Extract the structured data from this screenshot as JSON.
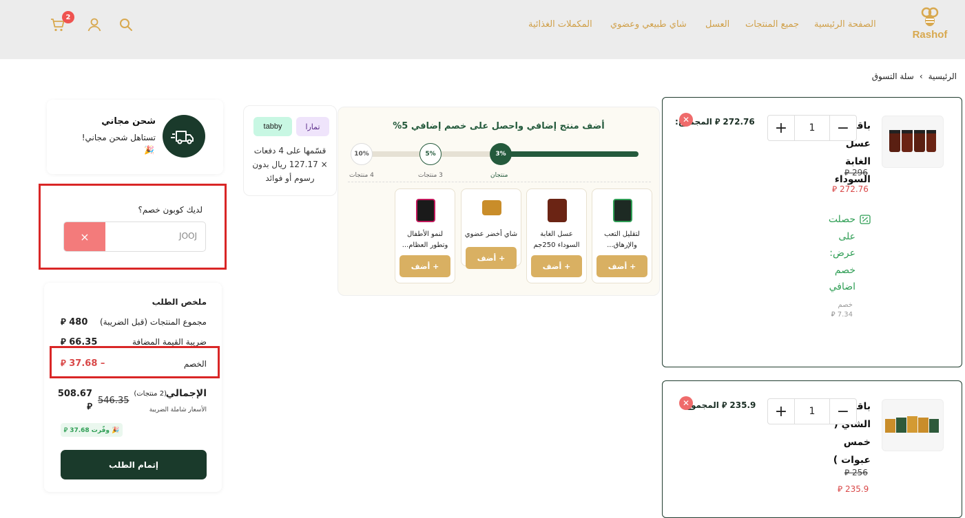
{
  "brand": {
    "name": "Rashof"
  },
  "nav": {
    "home": "الصفحة الرئيسية",
    "all_products": "جميع المنتجات",
    "honey": "العسل",
    "tea": "شاي طبيعي وعضوي",
    "supplements": "المكملات الغذائية"
  },
  "header": {
    "cart_count": "2"
  },
  "breadcrumb": {
    "home": "الرئيسية",
    "sep": "›",
    "current": "سلة التسوق"
  },
  "cart_items": [
    {
      "name": "باقة عسل الغابة السوداء",
      "old_price": "296 ⃁",
      "new_price": "272.76 ⃁",
      "qty": "1",
      "total_label": "المجموع:",
      "total_value": "272.76 ⃁",
      "offer": "حصلت على عرض: خصم اضافي",
      "discount_label": "خصم",
      "discount_value": "7.34 ⃁"
    },
    {
      "name": "باقة الشاي ( خمس عبوات )",
      "old_price": "256 ⃁",
      "new_price": "235.9 ⃁",
      "qty": "1",
      "total_label": "المجموع:",
      "total_value": "235.9 ⃁"
    }
  ],
  "upsell": {
    "title": "أضف منتج إضافي واحصل على خصم إضافي 5%",
    "steps": [
      {
        "pct": "3%",
        "label": "منتجان"
      },
      {
        "pct": "5%",
        "label": "3 منتجات"
      },
      {
        "pct": "10%",
        "label": "4 منتجات"
      }
    ],
    "progress_fraction": 0.33,
    "products": [
      {
        "name": "لتقليل التعب والإرهاق...",
        "add": "+ أضف"
      },
      {
        "name": "عسل الغابة السوداء 250جم",
        "add": "+ أضف"
      },
      {
        "name": "شاي أخضر عضوي",
        "add": "+ أضف"
      },
      {
        "name": "لنمو الأطفال وتطور العظام...",
        "add": "+ أضف"
      }
    ]
  },
  "bnpl": {
    "tamara": "تمارا",
    "tabby": "tabby",
    "text": "قسّمها على 4 دفعات × 127.17 ريال بدون رسوم أو فوائد"
  },
  "shipping": {
    "title": "شحن مجاني",
    "subtitle": "تستاهل شحن مجاني!",
    "emoji": "🎉"
  },
  "coupon": {
    "question": "لديك كوبون خصم؟",
    "value": "JOOJ",
    "clear": "×"
  },
  "summary": {
    "title": "ملخص الطلب",
    "subtotal_label": "مجموع المنتجات (قبل الضريبة)",
    "subtotal_value": "480 ⃁",
    "vat_label": "ضريبة القيمة المضافة",
    "vat_value": "66.35 ⃁",
    "discount_label": "الخصم",
    "discount_value": "– 37.68 ⃁",
    "total_label": "الإجمالي",
    "total_count": "(2 منتجات)",
    "total_old": "546.35",
    "total_new": "508.67 ⃁",
    "tax_note": "الأسعار شاملة الضريبة",
    "saved": "🎉 وفّرت 37.68 ⃁",
    "checkout": "إتمام الطلب"
  },
  "colors": {
    "brand": "#d8a84e",
    "dark": "#1a3a2b",
    "price_red": "#d94848",
    "offer_green": "#2f9e55"
  }
}
